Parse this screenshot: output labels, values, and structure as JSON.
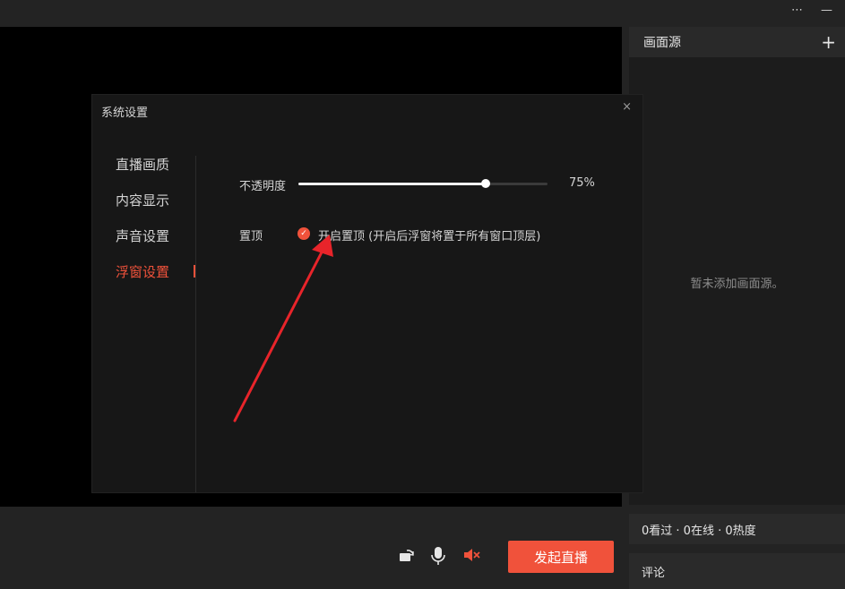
{
  "topbar": {
    "icons": [
      "more-icon",
      "minimize-icon"
    ]
  },
  "right_panel": {
    "title": "画面源",
    "empty_text": "暂未添加画面源。"
  },
  "stats": {
    "text": "0看过 · 0在线 · 0热度"
  },
  "comments": {
    "label": "评论"
  },
  "controls": {
    "icons": [
      "rotate-icon",
      "microphone-icon",
      "speaker-muted-icon"
    ],
    "live_button_label": "发起直播"
  },
  "dialog": {
    "title": "系统设置",
    "close_glyph": "×",
    "nav": [
      {
        "label": "直播画质"
      },
      {
        "label": "内容显示"
      },
      {
        "label": "声音设置"
      },
      {
        "label": "浮窗设置"
      }
    ],
    "active_nav_index": 3,
    "opacity": {
      "label": "不透明度",
      "value": 75,
      "value_text": "75%"
    },
    "pin_top": {
      "label": "置顶",
      "checked": true,
      "option_label": "开启置顶 (开启后浮窗将置于所有窗口顶层)"
    }
  },
  "colors": {
    "accent": "#f0523b"
  }
}
